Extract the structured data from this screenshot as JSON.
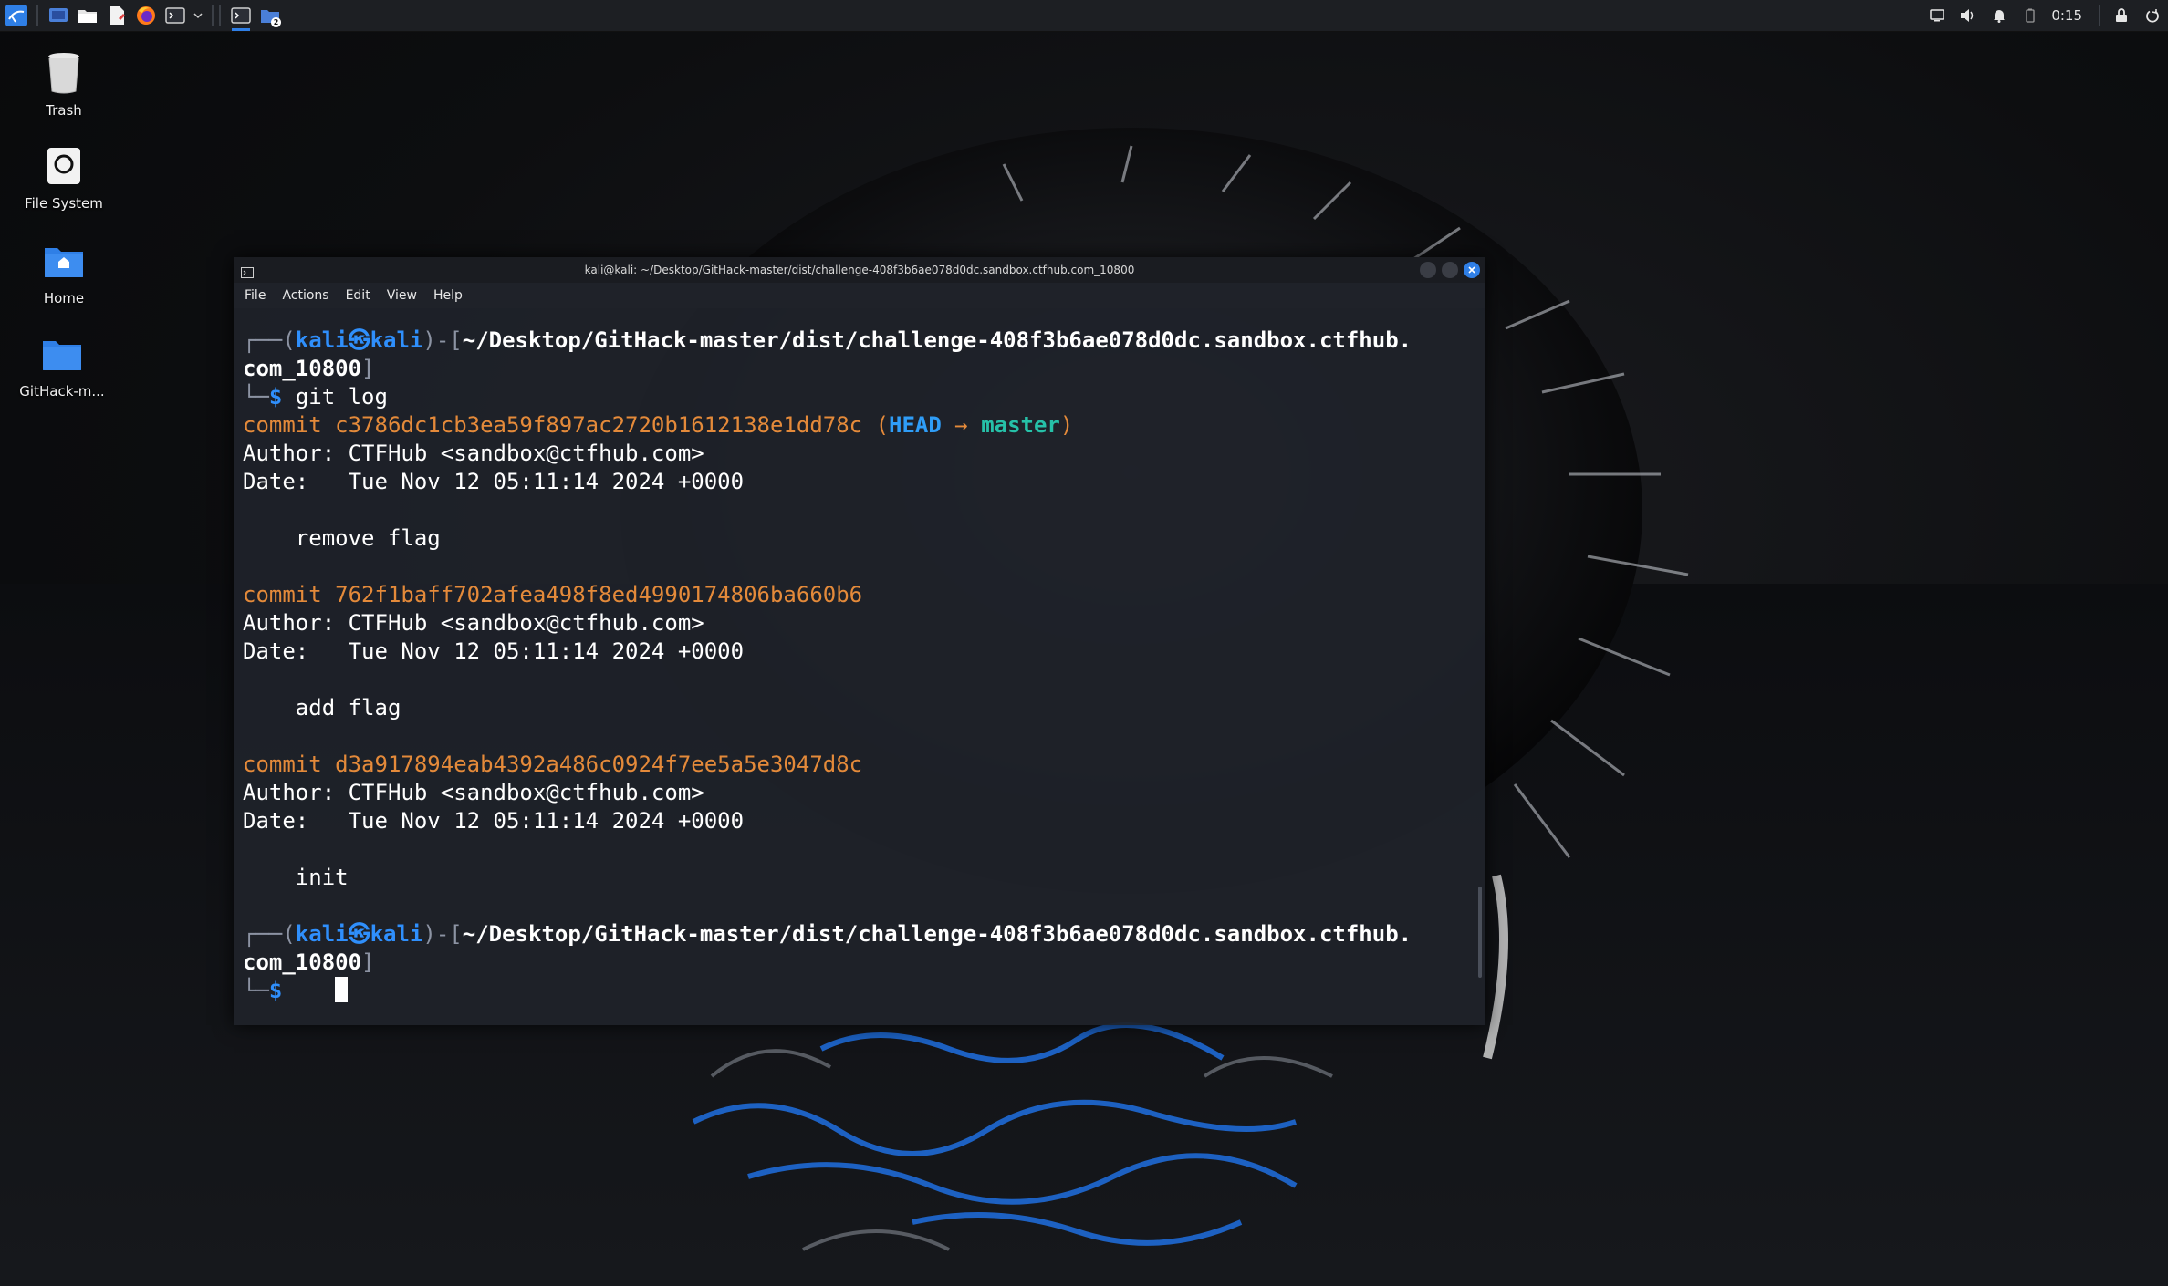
{
  "panel": {
    "launchers": [
      {
        "name": "kali-menu-icon"
      },
      {
        "name": "show-desktop-icon"
      },
      {
        "name": "file-manager-icon"
      },
      {
        "name": "text-editor-icon"
      },
      {
        "name": "firefox-icon"
      },
      {
        "name": "terminal-icon"
      }
    ],
    "tasks": [
      {
        "name": "terminal-task-icon"
      },
      {
        "name": "workspace-switcher-icon",
        "badge": "2"
      }
    ],
    "tray": {
      "clock": "0:15"
    },
    "accent": "#2f7fe6"
  },
  "desktop": {
    "icons": [
      {
        "label": "Trash",
        "icon": "trash-icon"
      },
      {
        "label": "File System",
        "icon": "drive-icon"
      },
      {
        "label": "Home",
        "icon": "home-folder-icon"
      },
      {
        "label": "GitHack-m...",
        "icon": "folder-icon"
      }
    ]
  },
  "terminal": {
    "title": "kali@kali: ~/Desktop/GitHack-master/dist/challenge-408f3b6ae078d0dc.sandbox.ctfhub.com_10800",
    "menu": [
      "File",
      "Actions",
      "Edit",
      "View",
      "Help"
    ],
    "prompt": {
      "user": "kali",
      "at": "㉿",
      "host": "kali",
      "path_1": "~/Desktop/GitHack-master/dist/challenge-408f3b6ae078d0dc.sandbox.ctfhub.",
      "path_2": "com_10800",
      "symbol": "$"
    },
    "command": "git log",
    "commits": [
      {
        "hash": "commit c3786dc1cb3ea59f897ac2720b1612138e1dd78c",
        "head": "HEAD",
        "arrow": "→",
        "branch": "master",
        "author": "Author: CTFHub <sandbox@ctfhub.com>",
        "date": "Date:   Tue Nov 12 05:11:14 2024 +0000",
        "message": "    remove flag"
      },
      {
        "hash": "commit 762f1baff702afea498f8ed4990174806ba660b6",
        "author": "Author: CTFHub <sandbox@ctfhub.com>",
        "date": "Date:   Tue Nov 12 05:11:14 2024 +0000",
        "message": "    add flag"
      },
      {
        "hash": "commit d3a917894eab4392a486c0924f7ee5a5e3047d8c",
        "author": "Author: CTFHub <sandbox@ctfhub.com>",
        "date": "Date:   Tue Nov 12 05:11:14 2024 +0000",
        "message": "    init"
      }
    ],
    "colors": {
      "prompt": "#2f8ffc",
      "hash": "#e48a3a",
      "branch": "#26c1a8",
      "close_button": "#2f7fe6"
    }
  }
}
